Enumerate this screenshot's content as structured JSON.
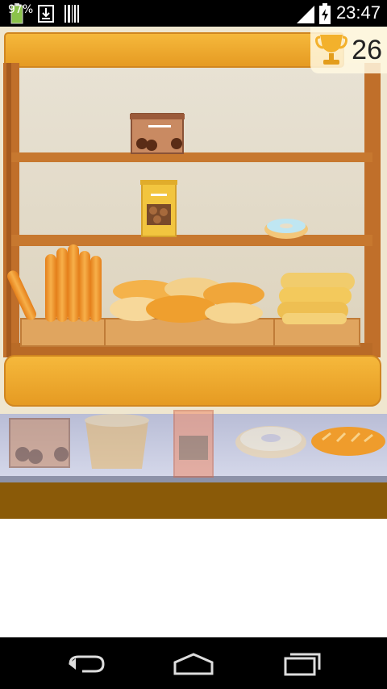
{
  "status_bar": {
    "battery_text": "97%",
    "time": "23:47",
    "icons": [
      "battery-icon",
      "download-icon",
      "barcode-icon",
      "signal-icon",
      "charging-battery-icon"
    ]
  },
  "score": {
    "value": "26",
    "icon": "trophy-icon"
  },
  "shelf": {
    "items": [
      "cookie-jar",
      "cookie-tin",
      "donut",
      "baguettes",
      "bread-loaves",
      "bread-rolls"
    ]
  },
  "counter": {
    "items": [
      "cookie-jar",
      "cupcake-wrapper",
      "cookie-tin",
      "donut",
      "bread-loaf"
    ]
  },
  "nav_bar": {
    "icons": [
      "back-icon",
      "home-icon",
      "recents-icon"
    ]
  },
  "colors": {
    "wood": "#c9762a",
    "wood_light": "#f4b43a",
    "wall": "#e9dfc8",
    "counter_base": "#8a5a08"
  }
}
